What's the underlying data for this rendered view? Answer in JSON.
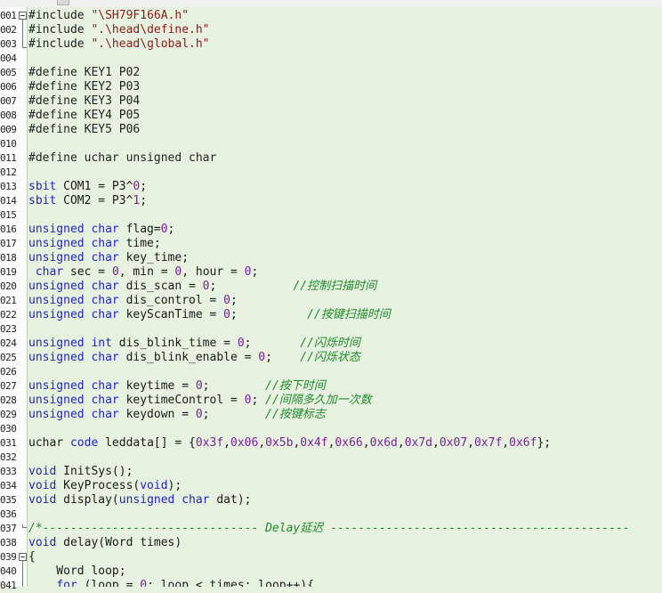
{
  "lines": [
    {
      "n": "001",
      "t": [
        {
          "c": "dir",
          "s": "#include "
        },
        {
          "c": "str",
          "s": "\"\\SH79F166A.h\""
        }
      ]
    },
    {
      "n": "002",
      "t": [
        {
          "c": "dir",
          "s": "#include "
        },
        {
          "c": "str",
          "s": "\".\\head\\define.h\""
        }
      ]
    },
    {
      "n": "003",
      "t": [
        {
          "c": "dir",
          "s": "#include "
        },
        {
          "c": "str",
          "s": "\".\\head\\global.h\""
        }
      ]
    },
    {
      "n": "004",
      "t": []
    },
    {
      "n": "005",
      "t": [
        {
          "c": "dir",
          "s": "#define KEY1 P02"
        }
      ]
    },
    {
      "n": "006",
      "t": [
        {
          "c": "dir",
          "s": "#define KEY2 P03"
        }
      ]
    },
    {
      "n": "007",
      "t": [
        {
          "c": "dir",
          "s": "#define KEY3 P04"
        }
      ]
    },
    {
      "n": "008",
      "t": [
        {
          "c": "dir",
          "s": "#define KEY4 P05"
        }
      ]
    },
    {
      "n": "009",
      "t": [
        {
          "c": "dir",
          "s": "#define KEY5 P06"
        }
      ]
    },
    {
      "n": "010",
      "t": []
    },
    {
      "n": "011",
      "t": [
        {
          "c": "dir",
          "s": "#define uchar unsigned char"
        }
      ]
    },
    {
      "n": "012",
      "t": []
    },
    {
      "n": "013",
      "t": [
        {
          "c": "kw",
          "s": "sbit"
        },
        {
          "c": "",
          "s": " COM1 = P3^"
        },
        {
          "c": "num",
          "s": "0"
        },
        {
          "c": "",
          "s": ";"
        }
      ]
    },
    {
      "n": "014",
      "t": [
        {
          "c": "kw",
          "s": "sbit"
        },
        {
          "c": "",
          "s": " COM2 = P3^"
        },
        {
          "c": "num",
          "s": "1"
        },
        {
          "c": "",
          "s": ";"
        }
      ]
    },
    {
      "n": "015",
      "t": []
    },
    {
      "n": "016",
      "t": [
        {
          "c": "kw",
          "s": "unsigned char"
        },
        {
          "c": "",
          "s": " flag="
        },
        {
          "c": "num",
          "s": "0"
        },
        {
          "c": "",
          "s": ";"
        }
      ]
    },
    {
      "n": "017",
      "t": [
        {
          "c": "kw",
          "s": "unsigned char"
        },
        {
          "c": "",
          "s": " time;"
        }
      ]
    },
    {
      "n": "018",
      "t": [
        {
          "c": "kw",
          "s": "unsigned char"
        },
        {
          "c": "",
          "s": " key_time;"
        }
      ]
    },
    {
      "n": "019",
      "t": [
        {
          "c": "",
          "s": " "
        },
        {
          "c": "kw",
          "s": "char"
        },
        {
          "c": "",
          "s": " sec = "
        },
        {
          "c": "num",
          "s": "0"
        },
        {
          "c": "",
          "s": ", min = "
        },
        {
          "c": "num",
          "s": "0"
        },
        {
          "c": "",
          "s": ", hour = "
        },
        {
          "c": "num",
          "s": "0"
        },
        {
          "c": "",
          "s": ";"
        }
      ]
    },
    {
      "n": "020",
      "t": [
        {
          "c": "kw",
          "s": "unsigned char"
        },
        {
          "c": "",
          "s": " dis_scan = "
        },
        {
          "c": "num",
          "s": "0"
        },
        {
          "c": "",
          "s": ";           "
        },
        {
          "c": "cm",
          "s": "//控制扫描时间"
        }
      ]
    },
    {
      "n": "021",
      "t": [
        {
          "c": "kw",
          "s": "unsigned char"
        },
        {
          "c": "",
          "s": " dis_control = "
        },
        {
          "c": "num",
          "s": "0"
        },
        {
          "c": "",
          "s": ";"
        }
      ]
    },
    {
      "n": "022",
      "t": [
        {
          "c": "kw",
          "s": "unsigned char"
        },
        {
          "c": "",
          "s": " keyScanTime = "
        },
        {
          "c": "num",
          "s": "0"
        },
        {
          "c": "",
          "s": ";          "
        },
        {
          "c": "cm",
          "s": "//按键扫描时间"
        }
      ]
    },
    {
      "n": "023",
      "t": []
    },
    {
      "n": "024",
      "t": [
        {
          "c": "kw",
          "s": "unsigned int"
        },
        {
          "c": "",
          "s": " dis_blink_time = "
        },
        {
          "c": "num",
          "s": "0"
        },
        {
          "c": "",
          "s": ";       "
        },
        {
          "c": "cm",
          "s": "//闪烁时间"
        }
      ]
    },
    {
      "n": "025",
      "t": [
        {
          "c": "kw",
          "s": "unsigned char"
        },
        {
          "c": "",
          "s": " dis_blink_enable = "
        },
        {
          "c": "num",
          "s": "0"
        },
        {
          "c": "",
          "s": ";    "
        },
        {
          "c": "cm",
          "s": "//闪烁状态"
        }
      ]
    },
    {
      "n": "026",
      "t": []
    },
    {
      "n": "027",
      "t": [
        {
          "c": "kw",
          "s": "unsigned char"
        },
        {
          "c": "",
          "s": " keytime = "
        },
        {
          "c": "num",
          "s": "0"
        },
        {
          "c": "",
          "s": ";        "
        },
        {
          "c": "cm",
          "s": "//按下时间"
        }
      ]
    },
    {
      "n": "028",
      "t": [
        {
          "c": "kw",
          "s": "unsigned char"
        },
        {
          "c": "",
          "s": " keytimeControl = "
        },
        {
          "c": "num",
          "s": "0"
        },
        {
          "c": "",
          "s": "; "
        },
        {
          "c": "cm",
          "s": "//间隔多久加一次数"
        }
      ]
    },
    {
      "n": "029",
      "t": [
        {
          "c": "kw",
          "s": "unsigned char"
        },
        {
          "c": "",
          "s": " keydown = "
        },
        {
          "c": "num",
          "s": "0"
        },
        {
          "c": "",
          "s": ";        "
        },
        {
          "c": "cm",
          "s": "//按键标志"
        }
      ]
    },
    {
      "n": "030",
      "t": []
    },
    {
      "n": "031",
      "t": [
        {
          "c": "",
          "s": "uchar "
        },
        {
          "c": "kw",
          "s": "code"
        },
        {
          "c": "",
          "s": " leddata[] = {"
        },
        {
          "c": "num",
          "s": "0x3f"
        },
        {
          "c": "",
          "s": ","
        },
        {
          "c": "num",
          "s": "0x06"
        },
        {
          "c": "",
          "s": ","
        },
        {
          "c": "num",
          "s": "0x5b"
        },
        {
          "c": "",
          "s": ","
        },
        {
          "c": "num",
          "s": "0x4f"
        },
        {
          "c": "",
          "s": ","
        },
        {
          "c": "num",
          "s": "0x66"
        },
        {
          "c": "",
          "s": ","
        },
        {
          "c": "num",
          "s": "0x6d"
        },
        {
          "c": "",
          "s": ","
        },
        {
          "c": "num",
          "s": "0x7d"
        },
        {
          "c": "",
          "s": ","
        },
        {
          "c": "num",
          "s": "0x07"
        },
        {
          "c": "",
          "s": ","
        },
        {
          "c": "num",
          "s": "0x7f"
        },
        {
          "c": "",
          "s": ","
        },
        {
          "c": "num",
          "s": "0x6f"
        },
        {
          "c": "",
          "s": "};"
        }
      ]
    },
    {
      "n": "032",
      "t": []
    },
    {
      "n": "033",
      "t": [
        {
          "c": "kw",
          "s": "void"
        },
        {
          "c": "",
          "s": " InitSys();"
        }
      ]
    },
    {
      "n": "034",
      "t": [
        {
          "c": "kw",
          "s": "void"
        },
        {
          "c": "",
          "s": " KeyProcess("
        },
        {
          "c": "kw",
          "s": "void"
        },
        {
          "c": "",
          "s": ");"
        }
      ]
    },
    {
      "n": "035",
      "t": [
        {
          "c": "kw",
          "s": "void"
        },
        {
          "c": "",
          "s": " display("
        },
        {
          "c": "kw",
          "s": "unsigned char"
        },
        {
          "c": "",
          "s": " dat);"
        }
      ]
    },
    {
      "n": "036",
      "t": []
    },
    {
      "n": "037",
      "t": [
        {
          "c": "cm",
          "s": "/*------------------------------- Delay延迟 -------------------------------------------"
        }
      ]
    },
    {
      "n": "038",
      "t": [
        {
          "c": "kw",
          "s": "void"
        },
        {
          "c": "",
          "s": " delay(Word times)"
        }
      ]
    },
    {
      "n": "039",
      "t": [
        {
          "c": "",
          "s": "{"
        }
      ]
    },
    {
      "n": "040",
      "t": [
        {
          "c": "",
          "s": "    Word loop;"
        }
      ]
    },
    {
      "n": "041",
      "t": [
        {
          "c": "",
          "s": "    "
        },
        {
          "c": "kw",
          "s": "for"
        },
        {
          "c": "",
          "s": " (loop = "
        },
        {
          "c": "num",
          "s": "0"
        },
        {
          "c": "",
          "s": "; loop < times; loop++){"
        }
      ]
    }
  ]
}
